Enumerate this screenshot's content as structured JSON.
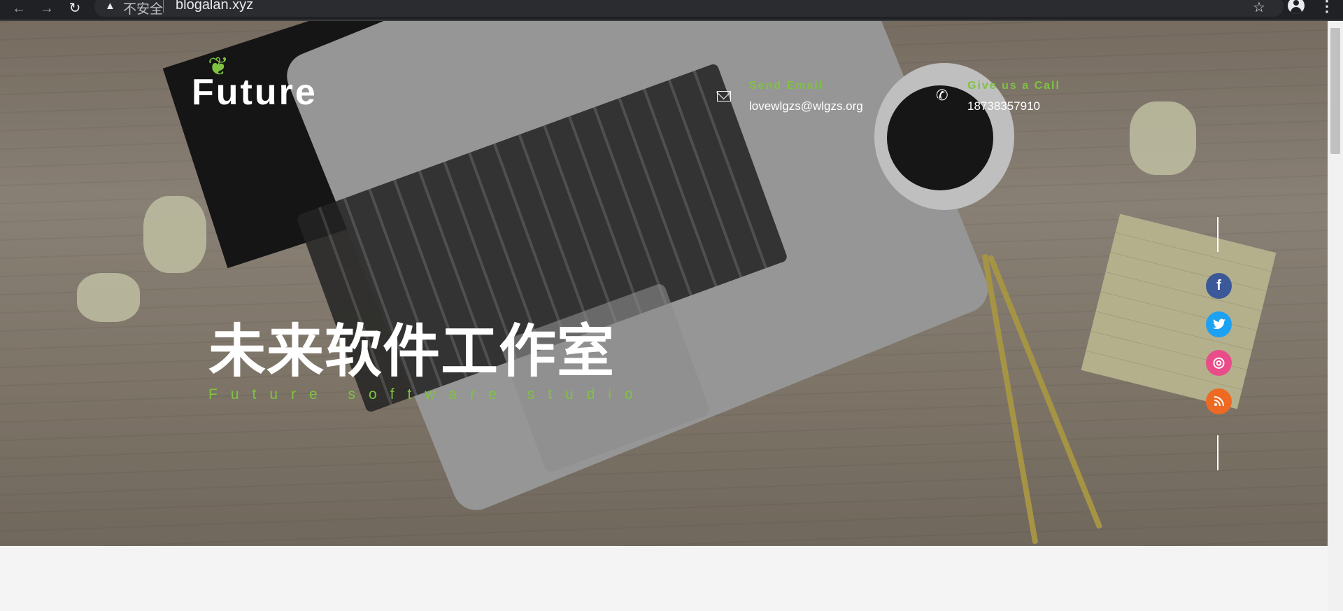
{
  "browser": {
    "back_icon": "arrow-left-icon",
    "forward_icon": "arrow-right-icon",
    "reload_icon": "reload-icon",
    "security_label": "不安全",
    "url": "blogalan.xyz",
    "bookmark_icon": "star-icon",
    "profile_icon": "avatar-icon",
    "menu_icon": "more-vertical-icon"
  },
  "header": {
    "logo_text": "Future",
    "email_label": "Send Email",
    "email_value": "lovewlgzs@wlgzs.org",
    "phone_label": "Give us a Call",
    "phone_value": "18738357910"
  },
  "hero": {
    "title": "未来软件工作室",
    "subtitle": "Future software studio"
  },
  "social": [
    {
      "name": "facebook",
      "glyph": "f",
      "color": "#3b5998"
    },
    {
      "name": "twitter",
      "glyph": "t",
      "color": "#1da1f2"
    },
    {
      "name": "dribbble",
      "glyph": "◎",
      "color": "#e94c89"
    },
    {
      "name": "rss",
      "glyph": "⁾",
      "color": "#ee6a23"
    }
  ],
  "colors": {
    "accent": "#7fc241",
    "chrome_bg": "#202124"
  }
}
